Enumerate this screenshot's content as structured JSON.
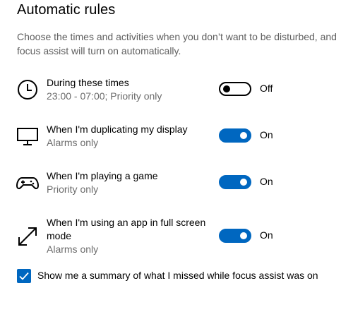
{
  "section_title": "Automatic rules",
  "description": "Choose the times and activities when you don’t want to be disturbed, and focus assist will turn on automatically.",
  "rules": [
    {
      "name": "During these times",
      "detail": "23:00 - 07:00; Priority only",
      "toggle_state": "Off",
      "enabled": false,
      "icon": "clock-icon"
    },
    {
      "name": "When I'm duplicating my display",
      "detail": "Alarms only",
      "toggle_state": "On",
      "enabled": true,
      "icon": "monitor-icon"
    },
    {
      "name": "When I'm playing a game",
      "detail": "Priority only",
      "toggle_state": "On",
      "enabled": true,
      "icon": "gamepad-icon"
    },
    {
      "name": "When I'm using an app in full screen mode",
      "detail": "Alarms only",
      "toggle_state": "On",
      "enabled": true,
      "icon": "fullscreen-arrows-icon"
    }
  ],
  "summary_checkbox": {
    "label": "Show me a summary of what I missed while focus assist was on",
    "checked": true
  },
  "colors": {
    "accent": "#0067c0",
    "secondary_text": "#6b6b6b"
  }
}
